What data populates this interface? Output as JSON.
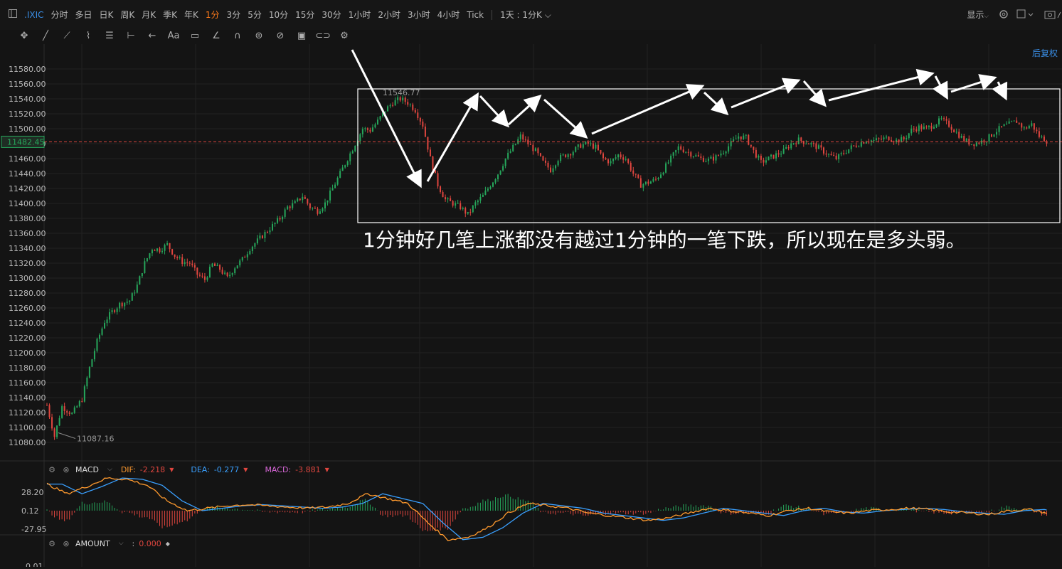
{
  "toolbar": {
    "symbol": ".IXIC",
    "timeframes": [
      "分时",
      "多日",
      "日K",
      "周K",
      "月K",
      "季K",
      "年K",
      "1分",
      "3分",
      "5分",
      "10分",
      "15分",
      "30分",
      "1小时",
      "2小时",
      "3小时",
      "4小时",
      "Tick"
    ],
    "active_timeframe": "1分",
    "range_selector": "1天 : 1分K",
    "display_label": "显示",
    "restore_label": "后复权"
  },
  "tools": [
    "move-icon",
    "line-icon",
    "trend-icon",
    "wave-icon",
    "channel-icon",
    "measure-icon",
    "arrow-icon",
    "text-icon",
    "note-icon",
    "ruler-icon",
    "magnet-icon",
    "lock-icon",
    "eye-icon",
    "trash-icon",
    "link-icon",
    "settings-icon"
  ],
  "price_axis": {
    "labels": [
      "11580.00",
      "11560.00",
      "11540.00",
      "11520.00",
      "11500.00",
      "11480.00",
      "11460.00",
      "11440.00",
      "11420.00",
      "11400.00",
      "11380.00",
      "11360.00",
      "11340.00",
      "11320.00",
      "11300.00",
      "11280.00",
      "11260.00",
      "11240.00",
      "11220.00",
      "11200.00",
      "11180.00",
      "11160.00",
      "11140.00",
      "11120.00",
      "11100.00",
      "11080.00"
    ],
    "current_price": "11482.45",
    "high_label": "11546.77",
    "low_label": "11087.16"
  },
  "annotation": "1分钟好几笔上涨都没有越过1分钟的一笔下跌，所以现在是多头弱。",
  "macd": {
    "name": "MACD",
    "dif_label": "DIF:",
    "dif_value": "-2.218",
    "dea_label": "DEA:",
    "dea_value": "-0.277",
    "macd_label": "MACD:",
    "macd_value": "-3.881",
    "axis": [
      "28.20",
      "0.12",
      "-27.95"
    ]
  },
  "amount": {
    "name": "AMOUNT",
    "value": "0.000",
    "axis": [
      "0.01"
    ]
  },
  "colors": {
    "up": "#26a65b",
    "down": "#e0463f",
    "dif": "#ff9a2e",
    "dea": "#3aa0ff",
    "macd": "#d666d6",
    "accent": "#ff7a1a",
    "link": "#3a8ee6"
  },
  "chart_data": {
    "type": "candlestick",
    "ylim": [
      11070,
      11590
    ],
    "close_path": [
      [
        0,
        11130
      ],
      [
        3,
        11088
      ],
      [
        6,
        11128
      ],
      [
        10,
        11118
      ],
      [
        14,
        11138
      ],
      [
        17,
        11180
      ],
      [
        20,
        11215
      ],
      [
        23,
        11242
      ],
      [
        26,
        11255
      ],
      [
        29,
        11265
      ],
      [
        33,
        11270
      ],
      [
        36,
        11290
      ],
      [
        39,
        11320
      ],
      [
        42,
        11340
      ],
      [
        45,
        11338
      ],
      [
        48,
        11345
      ],
      [
        51,
        11330
      ],
      [
        54,
        11322
      ],
      [
        57,
        11320
      ],
      [
        60,
        11305
      ],
      [
        63,
        11298
      ],
      [
        66,
        11318
      ],
      [
        69,
        11312
      ],
      [
        72,
        11300
      ],
      [
        75,
        11315
      ],
      [
        78,
        11325
      ],
      [
        81,
        11340
      ],
      [
        84,
        11350
      ],
      [
        87,
        11360
      ],
      [
        90,
        11370
      ],
      [
        93,
        11380
      ],
      [
        96,
        11395
      ],
      [
        99,
        11400
      ],
      [
        102,
        11410
      ],
      [
        105,
        11395
      ],
      [
        108,
        11390
      ],
      [
        111,
        11400
      ],
      [
        114,
        11420
      ],
      [
        117,
        11440
      ],
      [
        120,
        11460
      ],
      [
        123,
        11480
      ],
      [
        126,
        11500
      ],
      [
        129,
        11498
      ],
      [
        132,
        11510
      ],
      [
        135,
        11525
      ],
      [
        138,
        11535
      ],
      [
        141,
        11540
      ],
      [
        144,
        11535
      ],
      [
        147,
        11525
      ],
      [
        150,
        11505
      ],
      [
        153,
        11460
      ],
      [
        156,
        11425
      ],
      [
        159,
        11405
      ],
      [
        162,
        11400
      ],
      [
        165,
        11395
      ],
      [
        168,
        11385
      ],
      [
        171,
        11400
      ],
      [
        174,
        11410
      ],
      [
        177,
        11425
      ],
      [
        180,
        11440
      ],
      [
        183,
        11460
      ],
      [
        186,
        11475
      ],
      [
        189,
        11490
      ],
      [
        192,
        11480
      ],
      [
        195,
        11470
      ],
      [
        198,
        11455
      ],
      [
        201,
        11445
      ],
      [
        204,
        11460
      ],
      [
        207,
        11465
      ],
      [
        210,
        11470
      ],
      [
        213,
        11478
      ],
      [
        216,
        11480
      ],
      [
        219,
        11475
      ],
      [
        222,
        11460
      ],
      [
        225,
        11455
      ],
      [
        228,
        11465
      ],
      [
        231,
        11460
      ],
      [
        234,
        11440
      ],
      [
        237,
        11425
      ],
      [
        240,
        11428
      ],
      [
        243,
        11432
      ],
      [
        246,
        11445
      ],
      [
        249,
        11460
      ],
      [
        252,
        11475
      ],
      [
        255,
        11470
      ],
      [
        258,
        11465
      ],
      [
        261,
        11460
      ],
      [
        264,
        11458
      ],
      [
        267,
        11462
      ],
      [
        270,
        11470
      ],
      [
        273,
        11480
      ],
      [
        276,
        11490
      ],
      [
        279,
        11488
      ],
      [
        282,
        11470
      ],
      [
        285,
        11455
      ],
      [
        288,
        11460
      ],
      [
        291,
        11465
      ],
      [
        294,
        11470
      ],
      [
        297,
        11480
      ],
      [
        300,
        11485
      ],
      [
        303,
        11482
      ],
      [
        306,
        11478
      ],
      [
        309,
        11472
      ],
      [
        312,
        11465
      ],
      [
        315,
        11460
      ],
      [
        318,
        11468
      ],
      [
        321,
        11475
      ],
      [
        324,
        11480
      ],
      [
        327,
        11485
      ],
      [
        330,
        11484
      ],
      [
        333,
        11486
      ],
      [
        336,
        11488
      ],
      [
        339,
        11484
      ],
      [
        342,
        11486
      ],
      [
        345,
        11498
      ],
      [
        348,
        11502
      ],
      [
        351,
        11500
      ],
      [
        354,
        11506
      ],
      [
        357,
        11512
      ],
      [
        360,
        11505
      ],
      [
        363,
        11495
      ],
      [
        366,
        11485
      ],
      [
        369,
        11480
      ],
      [
        372,
        11482
      ],
      [
        375,
        11486
      ],
      [
        378,
        11495
      ],
      [
        381,
        11502
      ],
      [
        384,
        11506
      ],
      [
        387,
        11510
      ],
      [
        390,
        11500
      ],
      [
        393,
        11506
      ],
      [
        396,
        11490
      ],
      [
        399,
        11484
      ]
    ],
    "macd_path": [
      [
        0,
        22
      ],
      [
        8,
        14
      ],
      [
        16,
        20
      ],
      [
        24,
        27
      ],
      [
        32,
        26
      ],
      [
        40,
        21
      ],
      [
        48,
        8
      ],
      [
        56,
        0
      ],
      [
        64,
        2
      ],
      [
        72,
        4
      ],
      [
        80,
        5
      ],
      [
        88,
        4
      ],
      [
        96,
        3
      ],
      [
        104,
        2
      ],
      [
        112,
        3
      ],
      [
        120,
        6
      ],
      [
        128,
        14
      ],
      [
        136,
        10
      ],
      [
        144,
        6
      ],
      [
        152,
        -10
      ],
      [
        160,
        -24
      ],
      [
        168,
        -22
      ],
      [
        176,
        -14
      ],
      [
        184,
        -2
      ],
      [
        192,
        6
      ],
      [
        200,
        4
      ],
      [
        208,
        2
      ],
      [
        216,
        -2
      ],
      [
        224,
        -4
      ],
      [
        232,
        -6
      ],
      [
        240,
        -8
      ],
      [
        248,
        -6
      ],
      [
        256,
        -2
      ],
      [
        264,
        2
      ],
      [
        272,
        0
      ],
      [
        280,
        -2
      ],
      [
        288,
        -4
      ],
      [
        296,
        0
      ],
      [
        304,
        2
      ],
      [
        312,
        -1
      ],
      [
        320,
        -2
      ],
      [
        328,
        0
      ],
      [
        336,
        1
      ],
      [
        344,
        2
      ],
      [
        352,
        1
      ],
      [
        360,
        -1
      ],
      [
        368,
        -2
      ],
      [
        376,
        -3
      ],
      [
        384,
        0
      ],
      [
        392,
        1
      ],
      [
        399,
        -2
      ]
    ]
  }
}
